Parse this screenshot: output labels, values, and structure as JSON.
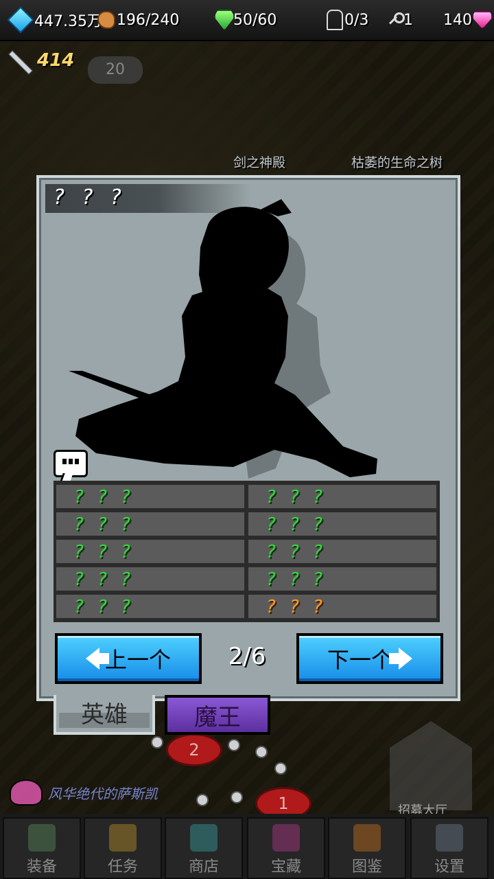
{
  "topbar": {
    "diamonds": "447.35万",
    "food": "196/240",
    "stamina": "50/60",
    "heroes": "0/3",
    "keys": "1",
    "gems": "140"
  },
  "power": "414",
  "level_badge": "20",
  "map": {
    "labels": [
      "剑之神殿",
      "枯萎的生命之树"
    ],
    "nodes": [
      "2",
      "1"
    ]
  },
  "panel": {
    "title": "? ? ?",
    "stats": [
      {
        "left": "? ? ?",
        "right": "? ? ?"
      },
      {
        "left": "? ? ?",
        "right": "? ? ?"
      },
      {
        "left": "? ? ?",
        "right": "? ? ?"
      },
      {
        "left": "? ? ?",
        "right": "? ? ?"
      },
      {
        "left": "? ? ?",
        "right": "? ? ?"
      }
    ],
    "prev_label": "上一个",
    "next_label": "下一个",
    "page": "2/6"
  },
  "tabs": {
    "hero": "英雄",
    "demon": "魔王"
  },
  "hero_name": "风华绝代的萨斯凯",
  "guild_label": "招募大厅",
  "bottom_nav": [
    "装备",
    "任务",
    "商店",
    "宝藏",
    "图鉴",
    "设置"
  ],
  "colors": {
    "panel": "#9aa6a9",
    "stat_green": "#32d83a",
    "stat_orange": "#ff9a1f",
    "button_blue": "#168ce8",
    "demon_tab": "#6e3fb8"
  }
}
